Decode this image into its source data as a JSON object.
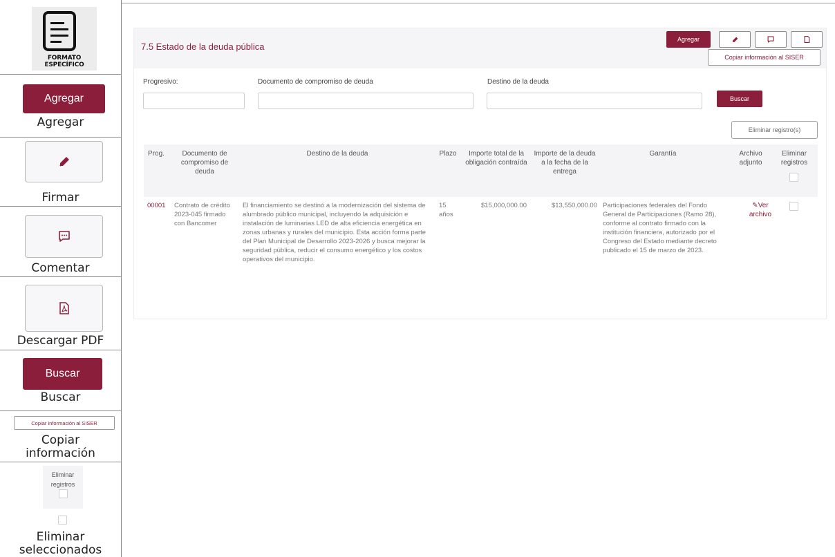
{
  "legend": {
    "formato": {
      "line1": "FORMATO",
      "line2": "ESPECÍFICO"
    },
    "agregar": {
      "button": "Agregar",
      "caption": "Agregar"
    },
    "firmar": {
      "caption": "Firmar"
    },
    "comentar": {
      "caption": "Comentar"
    },
    "pdf": {
      "caption": "Descargar PDF"
    },
    "buscar": {
      "button": "Buscar",
      "caption": "Buscar"
    },
    "copiar": {
      "button": "Copiar información al SISER",
      "caption_line1": "Copiar",
      "caption_line2": "información"
    },
    "eliminar": {
      "box_line1": "Eliminar",
      "box_line2": "registros",
      "caption_line1": "Eliminar",
      "caption_line2": "seleccionados"
    }
  },
  "card": {
    "title": "7.5 Estado de la deuda pública",
    "agregar_label": "Agregar",
    "copiar_label": "Copiar información al SISER",
    "icons": [
      "pen-icon",
      "comment-icon",
      "pdf-icon"
    ]
  },
  "filters": {
    "progresivo_label": "Progresivo:",
    "documento_label": "Documento de compromiso de deuda",
    "destino_label": "Destino de la deuda",
    "progresivo_value": "",
    "documento_value": "",
    "destino_value": "",
    "buscar_label": "Buscar",
    "eliminar_label": "Eliminar registro(s)"
  },
  "table": {
    "columns": [
      "Prog.",
      "Documento de compromiso de deuda",
      "Destino de la deuda",
      "Plazo",
      "Importe total de la obligación contraída",
      "Importe de la deuda a la fecha de la entrega",
      "Garantía",
      "Archivo adjunto",
      "Eliminar registros"
    ],
    "rows": [
      {
        "prog": "00001",
        "documento": "Contrato de crédito 2023-045 firmado con Bancomer",
        "destino": "El financiamiento se destinó a la modernización del sistema de alumbrado público municipal, incluyendo la adquisición e instalación de luminarias LED de alta eficiencia energética en zonas urbanas y rurales del municipio. Esta acción forma parte del Plan Municipal de Desarrollo 2023-2026 y busca mejorar la seguridad pública, reducir el consumo energético y los costos operativos del municipio.",
        "plazo": "15 años",
        "importe_total": "$15,000,000.00",
        "importe_fecha": "$13,550,000.00",
        "garantia": "Participaciones federales del Fondo General de Participaciones (Ramo 28), conforme al contrato firmado con la institución financiera, autorizado por el Congreso del Estado mediante decreto publicado el 15 de marzo de 2023.",
        "archivo": "Ver archivo"
      }
    ]
  },
  "colors": {
    "accent": "#8b1f3b",
    "header_bg": "#f5f5f7"
  }
}
